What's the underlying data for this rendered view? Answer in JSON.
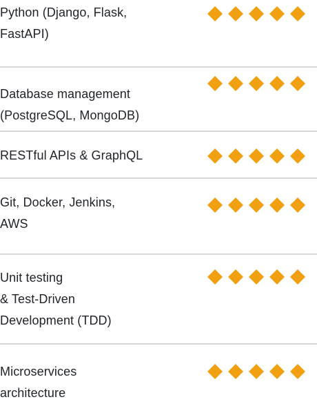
{
  "colors": {
    "accent": "#f0a010",
    "divider": "#d6d8dc",
    "text": "#1f2328"
  },
  "skills": [
    {
      "label": "Python (Django, Flask,\nFastAPI)",
      "rating": 5,
      "max_rating": 5
    },
    {
      "label": "Database management\n(PostgreSQL, MongoDB)",
      "rating": 5,
      "max_rating": 5
    },
    {
      "label": "RESTful APIs & GraphQL",
      "rating": 5,
      "max_rating": 5
    },
    {
      "label": "Git, Docker, Jenkins,\nAWS",
      "rating": 5,
      "max_rating": 5
    },
    {
      "label": "Unit testing\n& Test-Driven\nDevelopment (TDD)",
      "rating": 5,
      "max_rating": 5
    },
    {
      "label": "Microservices\narchitecture",
      "rating": 5,
      "max_rating": 5
    }
  ],
  "rating_icon": "diamond-icon"
}
